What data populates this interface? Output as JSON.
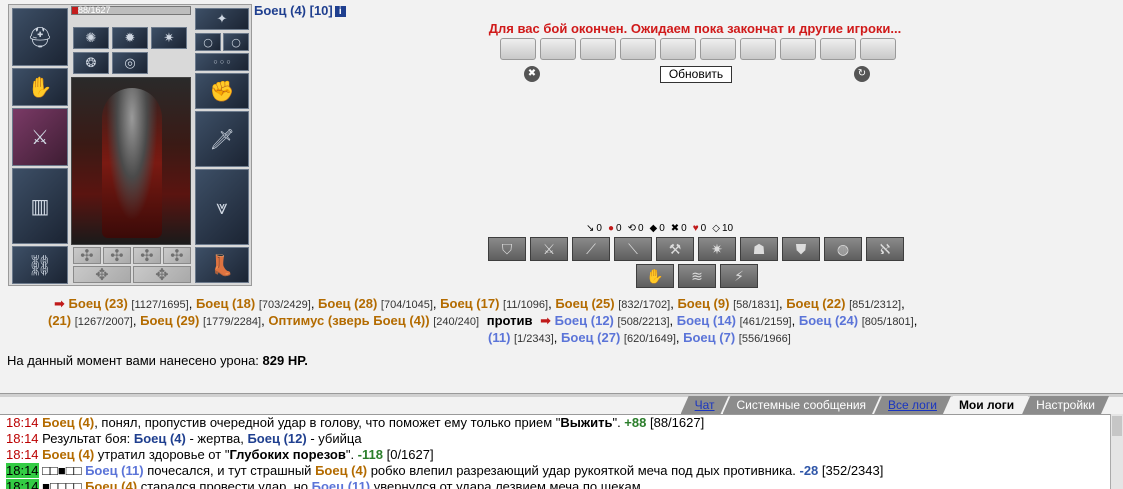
{
  "character": {
    "hp_text": "88/1627",
    "hp_fraction": 0.054
  },
  "header": {
    "fighter": "Боец (4) [10]",
    "info_icon": "i",
    "message": "Для вас бой окончен. Ожидаем пока закончат и другие игроки...",
    "refresh_label": "Обновить"
  },
  "stats": [
    {
      "icon": "sword-icon",
      "value": "0"
    },
    {
      "icon": "blood-drop-icon",
      "value": "0"
    },
    {
      "icon": "loop-icon",
      "value": "0"
    },
    {
      "icon": "shield-black-icon",
      "value": "0"
    },
    {
      "icon": "cross-icon",
      "value": "0"
    },
    {
      "icon": "heart-icon",
      "value": "0"
    },
    {
      "icon": "shield-outline-icon",
      "value": "10"
    }
  ],
  "battle": {
    "team1_line1": [
      {
        "name": "Боец (23)",
        "hp": "[1127/1695]"
      },
      {
        "name": "Боец (18)",
        "hp": "[703/2429]"
      },
      {
        "name": "Боец (28)",
        "hp": "[704/1045]"
      },
      {
        "name": "Боец (17)",
        "hp": "[11/1096]"
      },
      {
        "name": "Боец (25)",
        "hp": "[832/1702]"
      },
      {
        "name": "Боец (9)",
        "hp": "[58/1831]"
      },
      {
        "name": "Боец (22)",
        "hp": "[851/2312]"
      }
    ],
    "team1_line2": [
      {
        "name": "(21)",
        "hp": "[1267/2007]"
      },
      {
        "name": "Боец (29)",
        "hp": "[1779/2284]"
      },
      {
        "name": "Оптимус (зверь Боец (4))",
        "hp": "[240/240]"
      }
    ],
    "vs_label": "против",
    "team2_line2": [
      {
        "name": "Боец (12)",
        "hp": "[508/2213]"
      },
      {
        "name": "Боец (14)",
        "hp": "[461/2159]"
      },
      {
        "name": "Боец (24)",
        "hp": "[805/1801]"
      }
    ],
    "team2_line3": [
      {
        "name": "(11)",
        "hp": "[1/2343]"
      },
      {
        "name": "Боец (27)",
        "hp": "[620/1649]"
      },
      {
        "name": "Боец (7)",
        "hp": "[556/1966]"
      }
    ],
    "damage_prefix": "На данный момент вами нанесено урона:",
    "damage_value": "829 HP."
  },
  "tabs": [
    {
      "label": "Чат",
      "style": "link"
    },
    {
      "label": "Системные сообщения",
      "style": "normal"
    },
    {
      "label": "Все логи",
      "style": "link"
    },
    {
      "label": "Мои логи",
      "style": "active"
    },
    {
      "label": "Настройки",
      "style": "normal"
    }
  ],
  "log": {
    "l1": {
      "time": "18:14",
      "name": "Боец (4)",
      "text1": ", понял, пропустив очередной удар в голову, что поможет ему только прием \"",
      "quote": "Выжить",
      "text2": "\". ",
      "delta": "+88",
      "hp": " [88/1627]"
    },
    "l2": {
      "time": "18:14",
      "text1": " Результат боя: ",
      "name1": "Боец (4)",
      "text2": " - жертва, ",
      "name2": "Боец (12)",
      "text3": " - убийца"
    },
    "l3": {
      "time": "18:14",
      "name": "Боец (4)",
      "text1": " утратил здоровье от \"",
      "quote": "Глубоких порезов",
      "text2": "\". ",
      "delta": "-118",
      "hp": " [0/1627]"
    },
    "l4": {
      "time": "18:14",
      "marks": "□□■□□",
      "name1": "Боец (11)",
      "text1": " почесался, и тут страшный ",
      "name2": "Боец (4)",
      "text2": " робко влепил разрезающий удар рукояткой меча под дых противника. ",
      "delta": "-28",
      "hp": " [352/2343]"
    },
    "l5": {
      "time": "18:14",
      "marks": "■□□□□",
      "name1": "Боец (4)",
      "text1": " старался провести удар, но ",
      "name2": "Боец (11)",
      "text2": " увернулся от удара лезвием меча по щекам."
    }
  }
}
